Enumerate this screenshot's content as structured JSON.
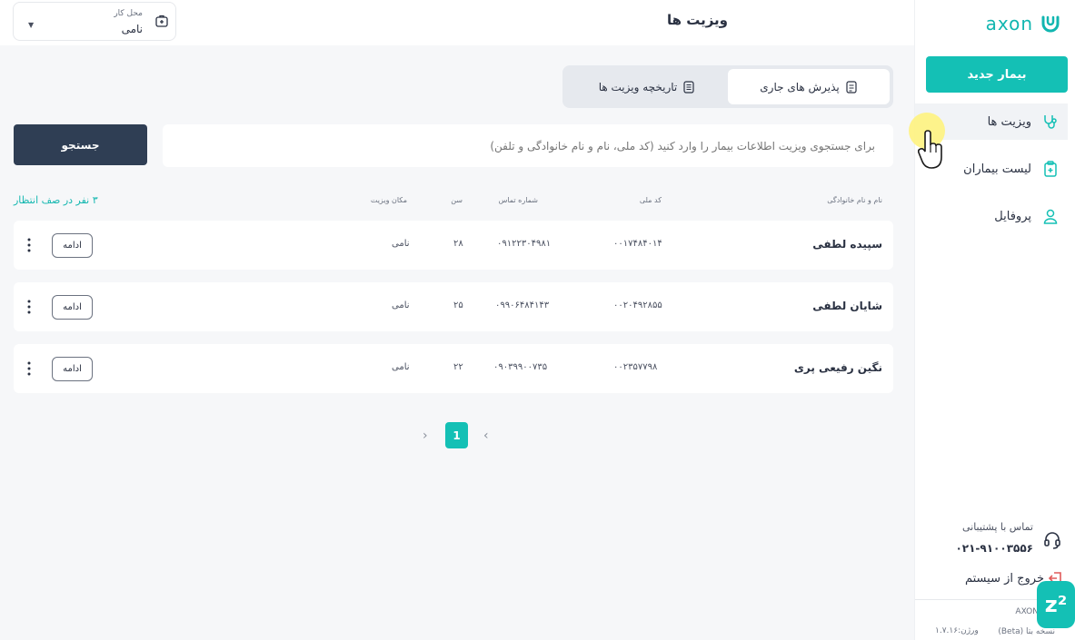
{
  "header": {
    "title": "ویزیت ها",
    "workplace": {
      "label": "محل کار",
      "value": "نامی"
    }
  },
  "sidebar": {
    "logo": "axon",
    "new_patient": "بیمار جدید",
    "items": [
      {
        "label": "ویزیت ها",
        "icon": "stethoscope-icon",
        "active": true
      },
      {
        "label": "لیست بیماران",
        "icon": "clipboard-icon",
        "active": false
      },
      {
        "label": "پروفایل",
        "icon": "user-icon",
        "active": false
      }
    ],
    "support": {
      "label": "تماس با پشتیبانی",
      "phone": "۰۲۱-۹۱۰۰۳۵۵۶"
    },
    "logout": "خروج از سیستم",
    "footer": {
      "brand": "AXON",
      "beta": "نسخه بتا (Beta)",
      "version": "ورژن:۱.۷.۱۶"
    }
  },
  "tabs": [
    {
      "label": "پذیرش های جاری",
      "active": true
    },
    {
      "label": "تاریخچه ویزیت ها",
      "active": false
    }
  ],
  "search": {
    "placeholder": "برای جستجوی ویزیت اطلاعات بیمار را وارد کنید (کد ملی، نام و نام خانوادگی و تلفن)",
    "button": "جستجو"
  },
  "table": {
    "headers": {
      "name": "نام و نام خانوادگی",
      "national_id": "کد ملی",
      "phone": "شماره تماس",
      "age": "سن",
      "location": "مکان ویزیت"
    },
    "queue": "۳ نفر در صف انتظار",
    "continue_label": "ادامه",
    "rows": [
      {
        "name": "سپیده لطفی",
        "national_id": "۰۰۱۷۴۸۴۰۱۴",
        "phone": "۰۹۱۲۲۳۰۴۹۸۱",
        "age": "۲۸",
        "location": "نامی"
      },
      {
        "name": "شایان لطفی",
        "national_id": "۰۰۲۰۴۹۲۸۵۵",
        "phone": "۰۹۹۰۶۴۸۴۱۴۳",
        "age": "۲۵",
        "location": "نامی"
      },
      {
        "name": "نگین رفیعی پری",
        "national_id": "۰۰۲۳۵۷۷۹۸",
        "phone": "۰۹۰۳۹۹۰۰۷۳۵",
        "age": "۲۲",
        "location": "نامی"
      }
    ]
  },
  "pagination": {
    "current": "1"
  },
  "colors": {
    "accent": "#14c0b5",
    "dark_button": "#2f3e54",
    "background": "#f6f7f9"
  }
}
